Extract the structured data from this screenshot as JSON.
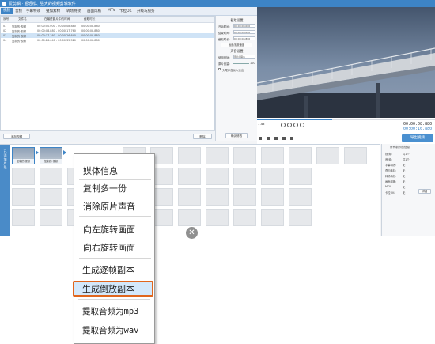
{
  "window": {
    "title": "爱剪辑 · 超轻松、强大的视频剪辑软件"
  },
  "menu": {
    "tabs": [
      "视频",
      "音频",
      "字幕特效",
      "叠加素材",
      "转场特效",
      "画面风格",
      "MTV",
      "卡拉OK",
      "升级与服务"
    ]
  },
  "clip_list": {
    "headers": [
      "序号",
      "文件名",
      "在最终影片中的时间",
      "截取时长"
    ],
    "rows": [
      {
        "no": "01",
        "name": "复制的·视频",
        "time": "00:00:00.000 - 00:00:08.880",
        "dur": "00:00:08.880"
      },
      {
        "no": "02",
        "name": "复制的·视频",
        "time": "00:00:08.880 - 00:00:17.760",
        "dur": "00:00:08.880"
      },
      {
        "no": "03",
        "name": "复制的·视频",
        "time": "00:00:17.760 - 00:00:26.640",
        "dur": "00:00:08.880"
      },
      {
        "no": "04",
        "name": "复制的·视频",
        "time": "00:00:26.640 - 00:00:35.520",
        "dur": "00:00:08.880"
      }
    ],
    "add_button": "添加视频",
    "delete_button": "删除"
  },
  "settings": {
    "cut_title": "截取设置",
    "start_label": "开始时间:",
    "start_value": "00:00:00.000",
    "end_label": "结束时间:",
    "end_value": "00:00:08.880",
    "duration_label": "截取时长:",
    "duration_value": "00:00:08.880",
    "speed_button": "画面/播放速度",
    "audio_title": "声音设置",
    "track_label": "使用音轨:",
    "track_value": "原片音轨1",
    "volume_label": "原片音量:",
    "volume_value": "100",
    "checkbox_label": "头尾声音淡入淡出",
    "confirm_button": "确认修改"
  },
  "player": {
    "current_time": "00:00:08.880",
    "total_time": "00:00:16.880",
    "export_button": "导出视频",
    "speed_value": "1.0x"
  },
  "timeline": {
    "side_label": "已添加片段",
    "clips": [
      {
        "label": "复制的·视频"
      },
      {
        "label": "复制的·视频"
      }
    ]
  },
  "props": {
    "title": "所有制作的信息",
    "lines": [
      "视    频:",
      "音    频:",
      "字幕特效:",
      "叠加素材:",
      "转场特效:",
      "画面风格:",
      "MTV:",
      "卡拉OK:"
    ],
    "values": [
      "共1个",
      "共1个",
      "无",
      "无",
      "无",
      "无",
      "无",
      "无"
    ],
    "button": "详细"
  },
  "context_menu": {
    "items": [
      {
        "label": "媒体信息"
      },
      {
        "label": "复制多一份"
      },
      {
        "label": "消除原片声音"
      },
      {
        "label": "向左旋转画面"
      },
      {
        "label": "向右旋转画面"
      },
      {
        "label": "生成逐帧副本"
      },
      {
        "label": "生成倒放副本",
        "highlighted": true
      },
      {
        "label": "提取音频为mp3"
      },
      {
        "label": "提取音频为wav"
      }
    ]
  },
  "colors": {
    "accent": "#3d84c6",
    "highlight_border": "#e0661d",
    "highlight_fill": "#d3e8fb"
  }
}
